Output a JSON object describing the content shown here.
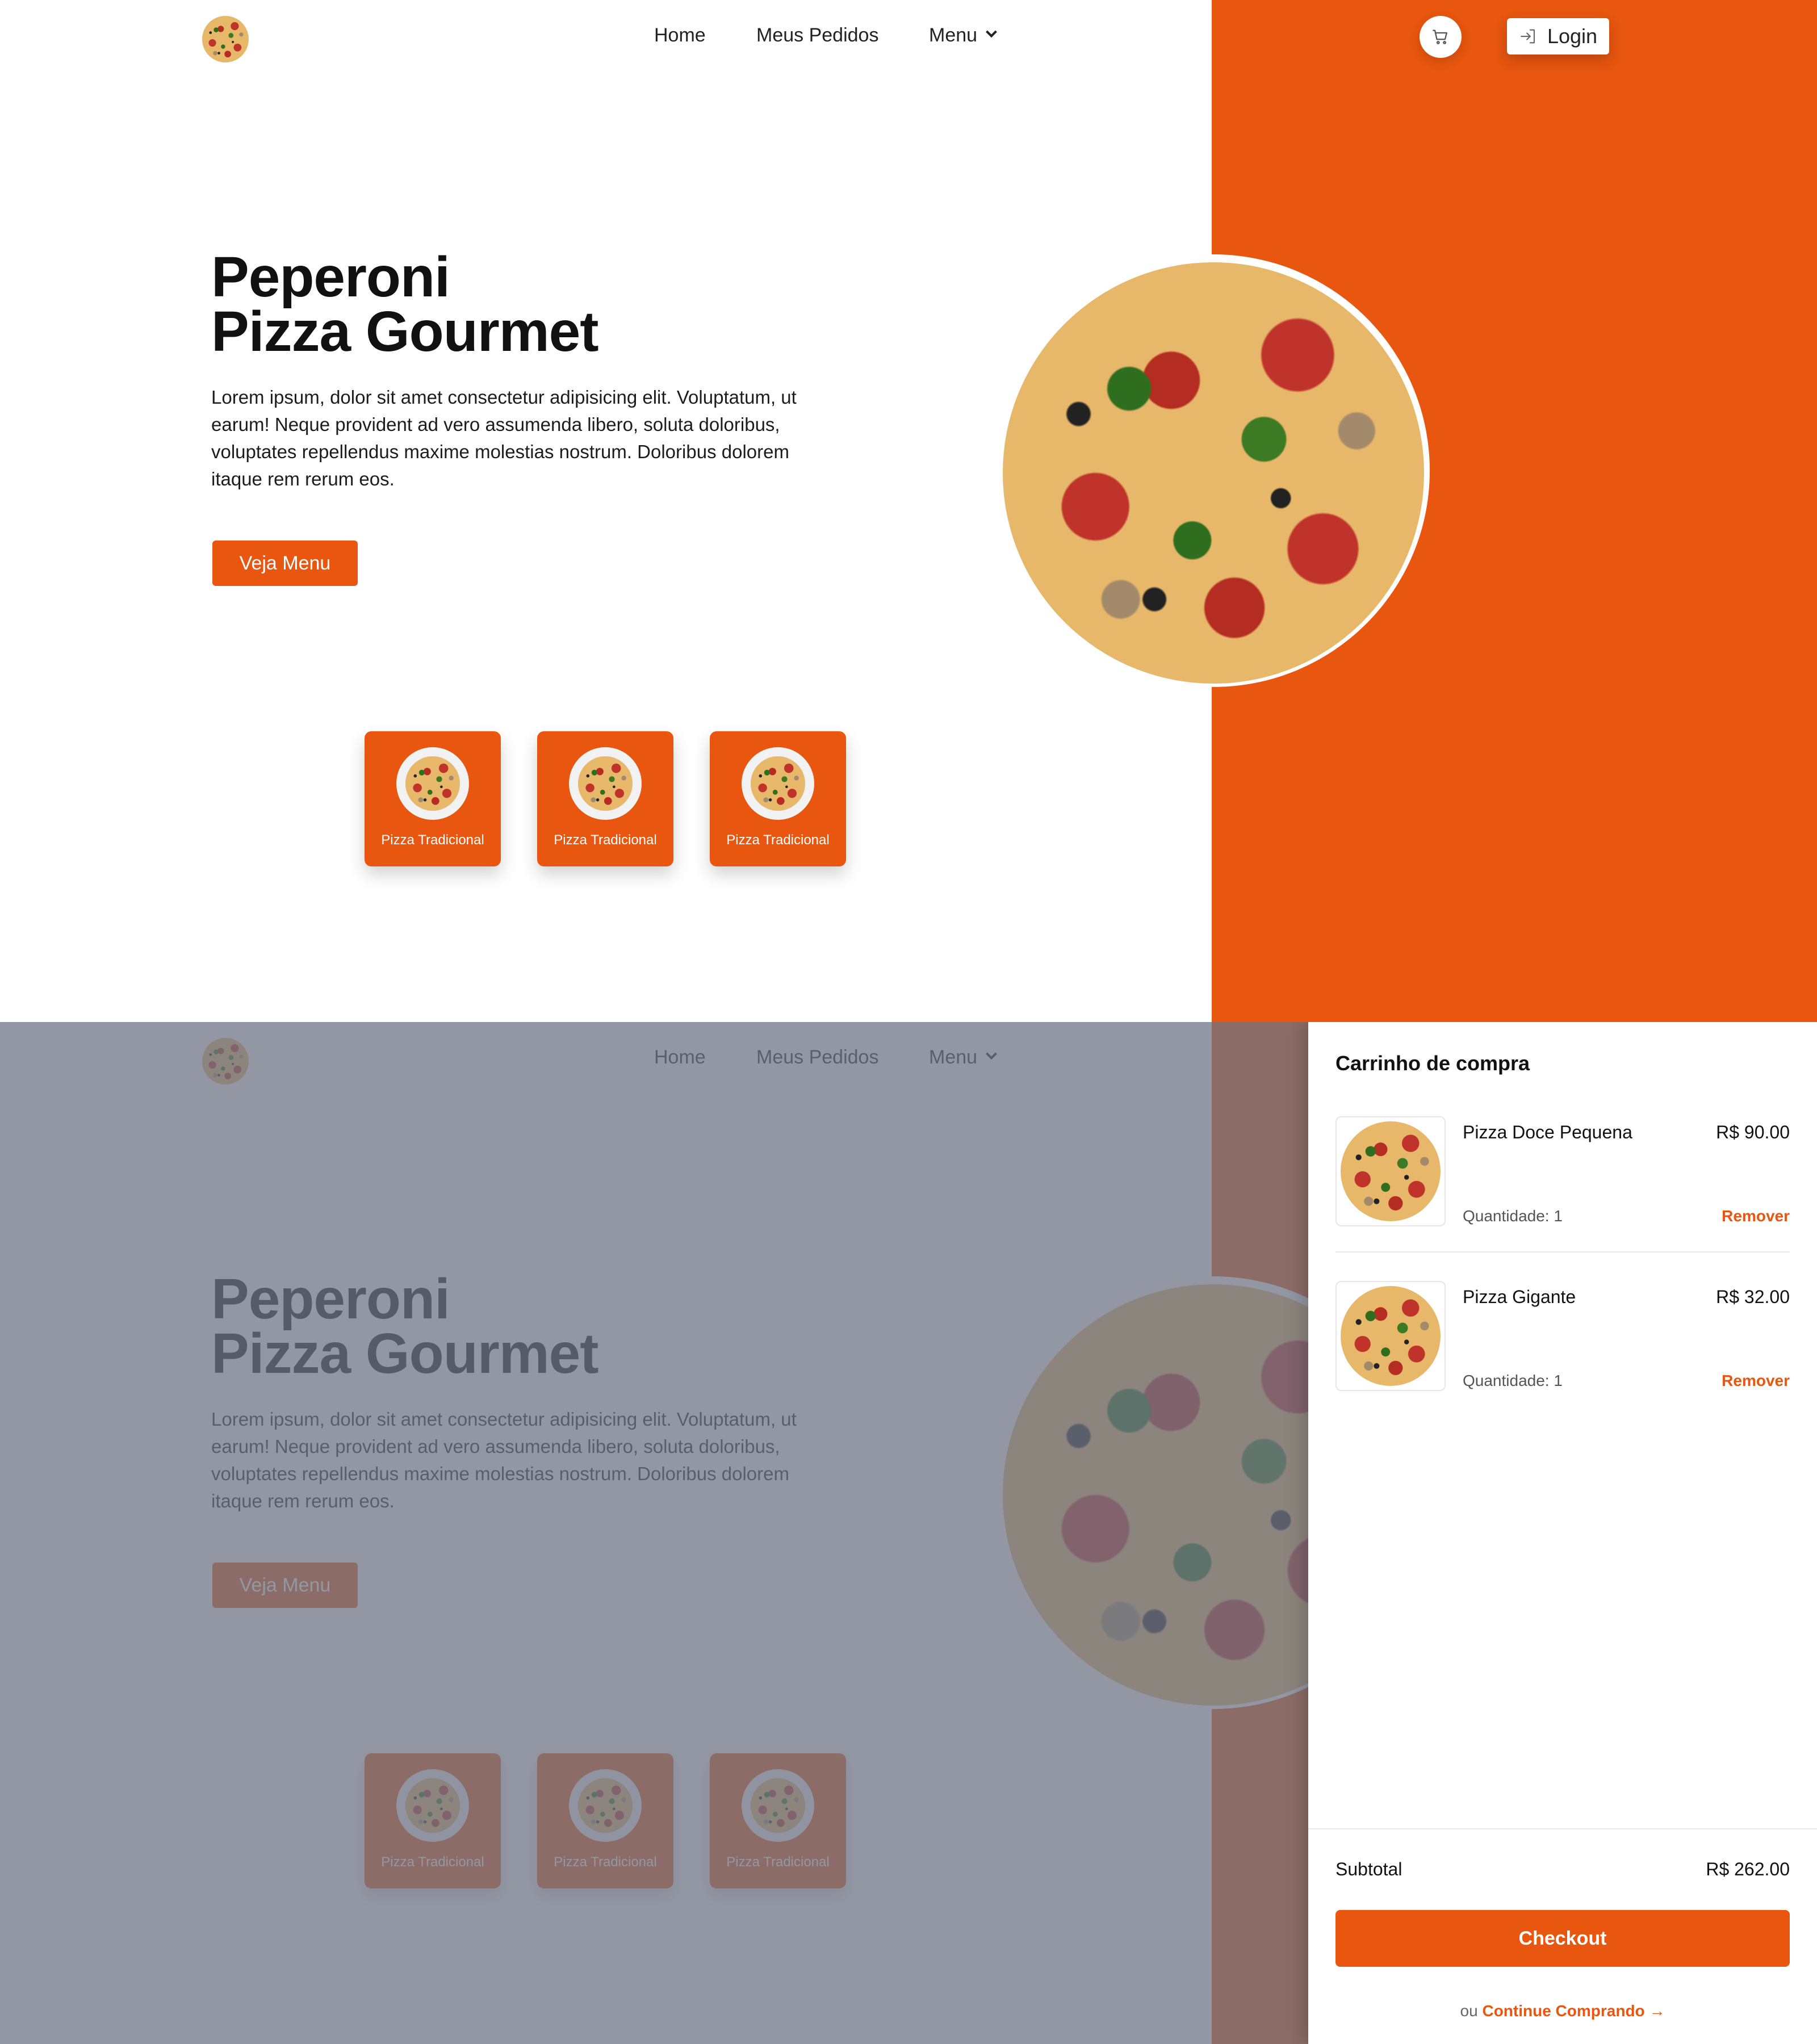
{
  "nav": {
    "home": "Home",
    "orders": "Meus Pedidos",
    "menu": "Menu",
    "login": "Login"
  },
  "hero": {
    "title_line1": "Peperoni",
    "title_line2": "Pizza Gourmet",
    "description": "Lorem ipsum, dolor sit amet consectetur adipisicing elit. Voluptatum, ut earum! Neque provident ad vero assumenda libero, soluta doloribus, voluptates repellendus maxime molestias nostrum. Doloribus dolorem itaque rem rerum eos.",
    "cta": "Veja Menu"
  },
  "categories": [
    {
      "label": "Pizza Tradicional"
    },
    {
      "label": "Pizza Tradicional"
    },
    {
      "label": "Pizza Tradicional"
    }
  ],
  "cart": {
    "title": "Carrinho de compra",
    "items": [
      {
        "name": "Pizza Doce Pequena",
        "price": "R$ 90.00",
        "quantity": "Quantidade: 1",
        "remove": "Remover"
      },
      {
        "name": "Pizza Gigante",
        "price": "R$ 32.00",
        "quantity": "Quantidade: 1",
        "remove": "Remover"
      }
    ],
    "subtotal_label": "Subtotal",
    "subtotal_value": "R$ 262.00",
    "checkout": "Checkout",
    "continue_prefix": "ou",
    "continue_link": "Continue Comprando →"
  },
  "colors": {
    "accent": "#e8560f",
    "overlay": "#6e7484"
  },
  "icons": {
    "cart": "cart-icon",
    "login": "login-icon",
    "chevron": "chevron-down-icon"
  }
}
